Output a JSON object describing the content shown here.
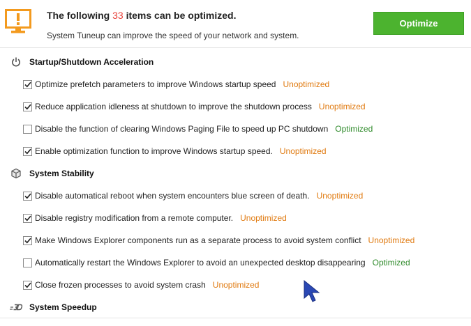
{
  "header": {
    "headline_before": "The following ",
    "count": "33",
    "headline_after": " items can be optimized.",
    "subtitle": "System Tuneup can improve the speed of your network and system.",
    "optimize_label": "Optimize",
    "icon": "monitor-warning-icon"
  },
  "colors": {
    "accent_green": "#4cb32f",
    "count_red": "#e8423b",
    "unoptimized_orange": "#e07a10",
    "optimized_green": "#2e8a2a",
    "icon_orange": "#f39a1e"
  },
  "sections": [
    {
      "title": "Startup/Shutdown Acceleration",
      "icon": "power-icon",
      "items": [
        {
          "label": "Optimize prefetch parameters to improve Windows startup speed",
          "checked": true,
          "status": "Unoptimized"
        },
        {
          "label": "Reduce application idleness at shutdown to improve the shutdown process",
          "checked": true,
          "status": "Unoptimized"
        },
        {
          "label": "Disable the function of clearing Windows Paging File to speed up PC shutdown",
          "checked": false,
          "status": "Optimized"
        },
        {
          "label": "Enable optimization function to improve Windows startup speed.",
          "checked": true,
          "status": "Unoptimized"
        }
      ]
    },
    {
      "title": "System Stability",
      "icon": "cube-icon",
      "items": [
        {
          "label": "Disable automatical reboot when system encounters blue screen of death.",
          "checked": true,
          "status": "Unoptimized"
        },
        {
          "label": "Disable registry modification from a remote computer.",
          "checked": true,
          "status": "Unoptimized"
        },
        {
          "label": "Make Windows Explorer components run as a separate process to avoid system conflict",
          "checked": true,
          "status": "Unoptimized"
        },
        {
          "label": "Automatically restart the Windows Explorer to avoid an unexpected desktop disappearing",
          "checked": false,
          "status": "Optimized"
        },
        {
          "label": "Close frozen processes to avoid system crash",
          "checked": true,
          "status": "Unoptimized"
        }
      ]
    },
    {
      "title": "System Speedup",
      "icon": "speed-3d-icon",
      "items": []
    }
  ]
}
